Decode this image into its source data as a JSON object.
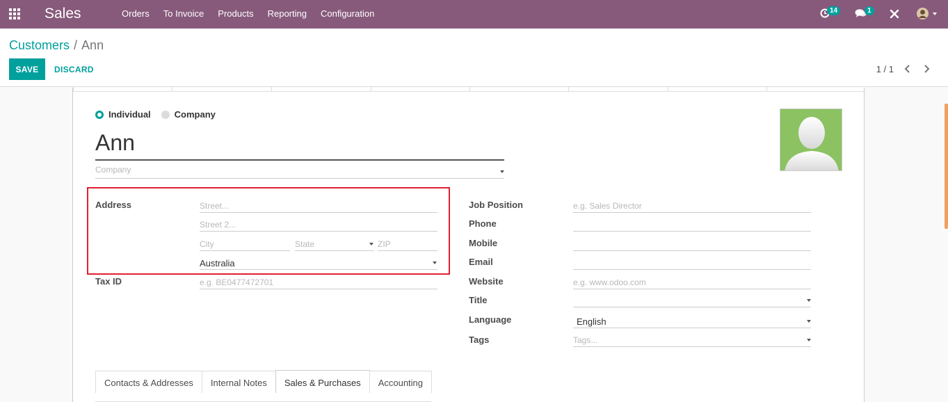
{
  "navbar": {
    "app_name": "Sales",
    "menu": [
      "Orders",
      "To Invoice",
      "Products",
      "Reporting",
      "Configuration"
    ],
    "activity_count": "14",
    "message_count": "1"
  },
  "breadcrumb": {
    "parent": "Customers",
    "separator": "/",
    "current": "Ann"
  },
  "actions": {
    "save_label": "SAVE",
    "discard_label": "DISCARD"
  },
  "pager": {
    "value": "1 / 1"
  },
  "form": {
    "type_options": [
      "Individual",
      "Company"
    ],
    "selected_type": "Individual",
    "name": "Ann",
    "company_placeholder": "Company",
    "address_label": "Address",
    "street_placeholder": "Street...",
    "street2_placeholder": "Street 2...",
    "city_placeholder": "City",
    "state_placeholder": "State",
    "zip_placeholder": "ZIP",
    "country": "Australia",
    "tax_id_label": "Tax ID",
    "tax_id_placeholder": "e.g. BE0477472701",
    "job_position_label": "Job Position",
    "job_position_placeholder": "e.g. Sales Director",
    "phone_label": "Phone",
    "mobile_label": "Mobile",
    "email_label": "Email",
    "website_label": "Website",
    "website_placeholder": "e.g. www.odoo.com",
    "title_label": "Title",
    "language_label": "Language",
    "language": "English",
    "tags_label": "Tags",
    "tags_placeholder": "Tags..."
  },
  "tabs": [
    "Contacts & Addresses",
    "Internal Notes",
    "Sales & Purchases",
    "Accounting"
  ],
  "active_tab": "Sales & Purchases",
  "colors": {
    "navbar": "#875a7b",
    "accent": "#00a09d",
    "highlight": "#e0202e",
    "avatar_bg": "#8cc262"
  },
  "icons": [
    "apps-grid-icon",
    "clock-icon",
    "chat-icon",
    "close-cross-icon",
    "user-avatar-icon",
    "chevron-left-icon",
    "chevron-right-icon",
    "caret-down-icon"
  ]
}
